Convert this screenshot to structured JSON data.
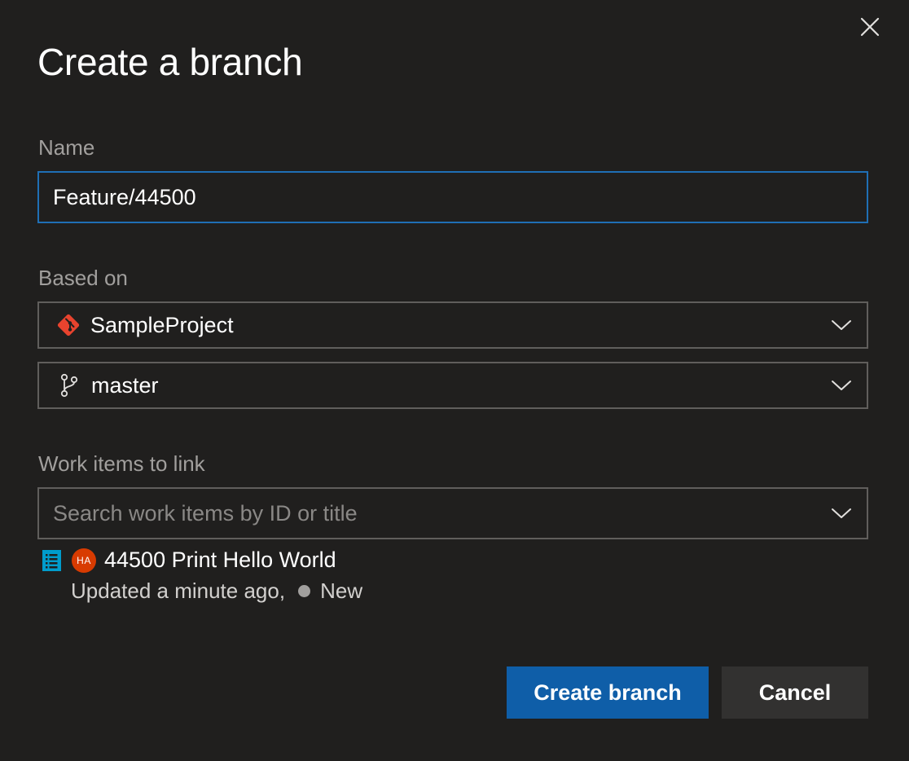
{
  "dialog": {
    "title": "Create a branch",
    "close_icon": "close-icon"
  },
  "name": {
    "label": "Name",
    "value": "Feature/44500"
  },
  "based_on": {
    "label": "Based on",
    "repository": {
      "icon": "git-repo-icon",
      "value": "SampleProject",
      "icon_color": "#e8432e"
    },
    "branch": {
      "icon": "branch-icon",
      "value": "master"
    }
  },
  "work_items": {
    "label": "Work items to link",
    "search_placeholder": "Search work items by ID or title",
    "items": [
      {
        "type_icon": "requirement-icon",
        "type_color": "#009ccc",
        "avatar_initials": "HA",
        "avatar_color": "#d83b01",
        "title": "44500 Print Hello World",
        "updated": "Updated a minute ago,",
        "state": "New",
        "state_color": "#a19f9d"
      }
    ]
  },
  "actions": {
    "create_label": "Create branch",
    "cancel_label": "Cancel",
    "primary_color": "#0f5ea8"
  }
}
